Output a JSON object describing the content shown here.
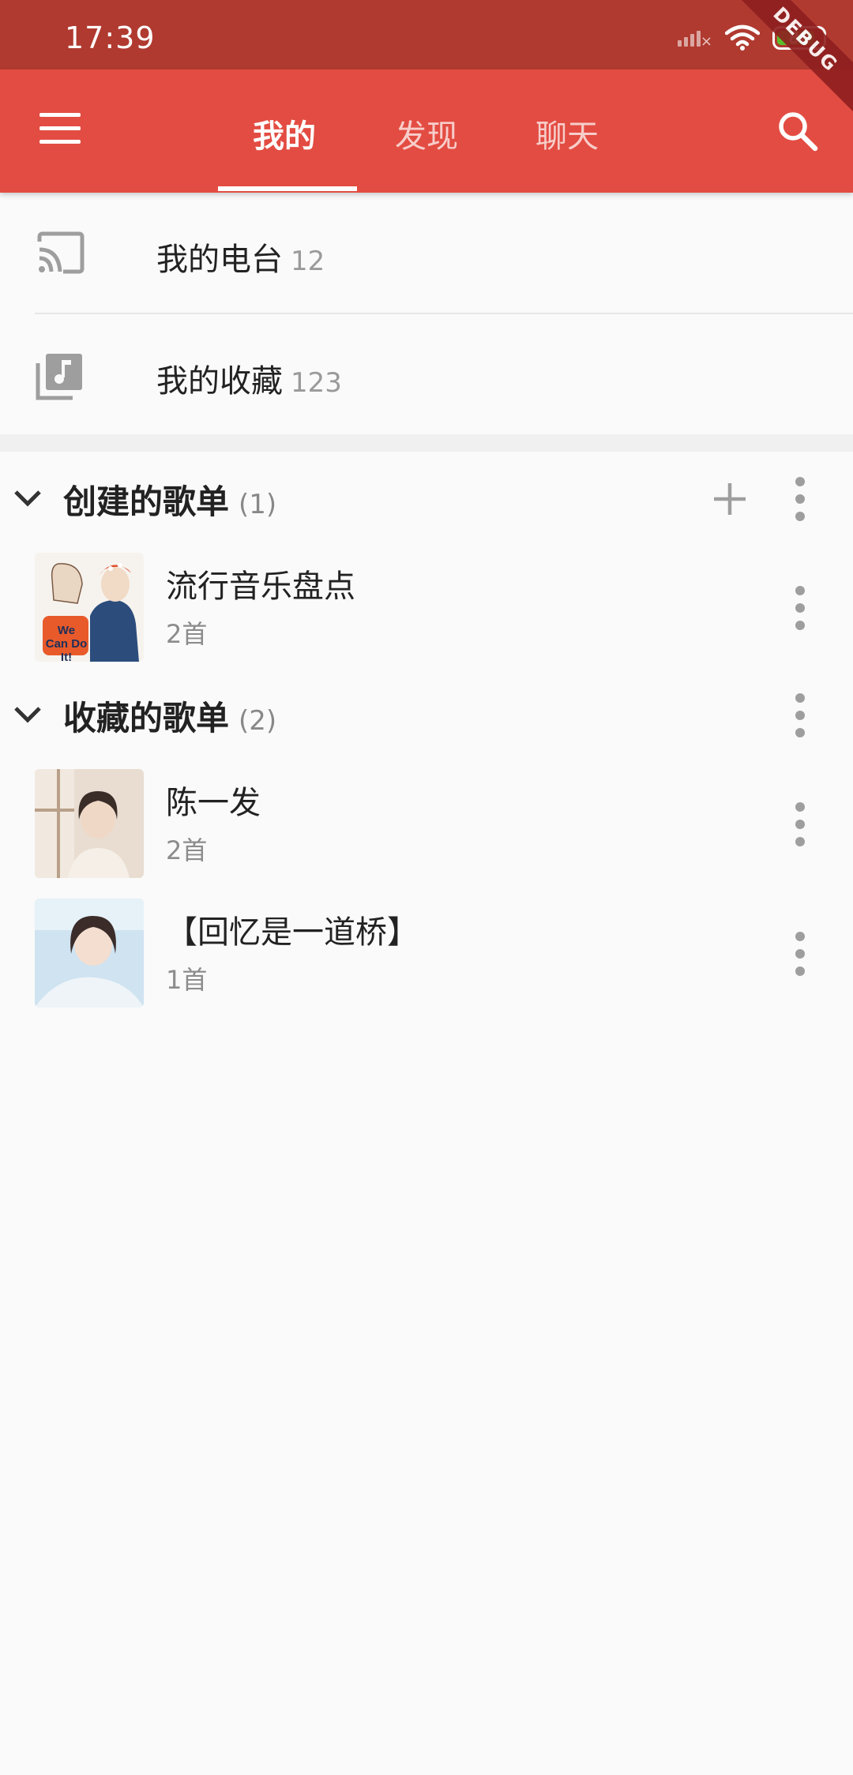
{
  "status_bar": {
    "time": "17:39",
    "battery_level": "86",
    "battery_fraction": 0.86,
    "debug_label": "DEBUG",
    "bar_color": "#b03a30"
  },
  "app_bar": {
    "tabs": [
      {
        "label": "我的",
        "active": true
      },
      {
        "label": "发现",
        "active": false
      },
      {
        "label": "聊天",
        "active": false
      }
    ],
    "bar_color": "#e34c42",
    "menu_icon": "menu-icon",
    "search_icon": "search-icon"
  },
  "entries": [
    {
      "icon": "cast-icon",
      "label": "我的电台",
      "count": "12"
    },
    {
      "icon": "music-library-icon",
      "label": "我的收藏",
      "count": "123"
    }
  ],
  "sections": [
    {
      "title": "创建的歌单",
      "count": "(1)",
      "playlists": [
        {
          "title": "流行音乐盘点",
          "subtitle": "2首",
          "cover": "we-can-do-it-poster"
        }
      ]
    },
    {
      "title": "收藏的歌单",
      "count": "(2)",
      "playlists": [
        {
          "title": "陈一发",
          "subtitle": "2首",
          "cover": "portrait-photo"
        },
        {
          "title": "【回忆是一道桥】",
          "subtitle": "1首",
          "cover": "portrait-photo-blue"
        }
      ]
    }
  ],
  "poster_text": "We Can Do It!"
}
